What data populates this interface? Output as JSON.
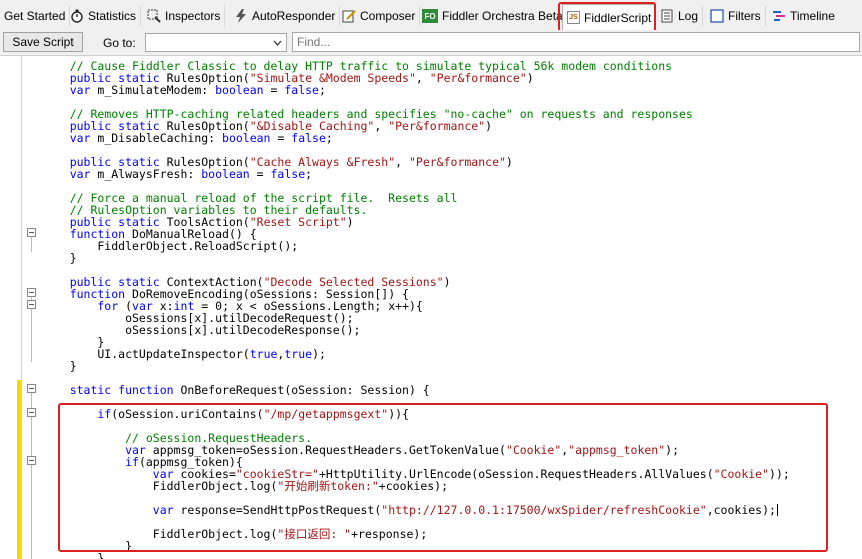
{
  "tabs": [
    {
      "label": "Get Started",
      "icon": "none",
      "active": false
    },
    {
      "label": "Statistics",
      "icon": "stopwatch-icon",
      "active": false
    },
    {
      "label": "Inspectors",
      "icon": "inspect-icon",
      "active": false
    },
    {
      "label": "AutoResponder",
      "icon": "lightning-icon",
      "active": false
    },
    {
      "label": "Composer",
      "icon": "compose-icon",
      "active": false
    },
    {
      "label": "Fiddler Orchestra Beta",
      "icon": "fo-icon",
      "icon_text": "FO",
      "active": false
    },
    {
      "label": "FiddlerScript",
      "icon": "script-icon",
      "icon_text": "JS",
      "active": true
    },
    {
      "label": "Log",
      "icon": "log-icon",
      "active": false
    },
    {
      "label": "Filters",
      "icon": "checkbox-icon",
      "active": false
    },
    {
      "label": "Timeline",
      "icon": "timeline-icon",
      "active": false
    }
  ],
  "toolbar": {
    "save_label": "Save Script",
    "goto_label": "Go to:",
    "goto_value": "",
    "find_placeholder": "Find..."
  },
  "code_lines": [
    [
      [
        "cm",
        "    // Cause Fiddler Classic to delay HTTP traffic to simulate typical 56k modem conditions"
      ]
    ],
    [
      [
        "kw",
        "    public static "
      ],
      [
        "pl",
        "RulesOption("
      ],
      [
        "st",
        "\"Simulate &Modem Speeds\""
      ],
      [
        "pl",
        ", "
      ],
      [
        "st",
        "\"Per&formance\""
      ],
      [
        "pl",
        ")"
      ]
    ],
    [
      [
        "kw",
        "    var "
      ],
      [
        "pl",
        "m_SimulateModem: "
      ],
      [
        "kw",
        "boolean"
      ],
      [
        "pl",
        " = "
      ],
      [
        "kw",
        "false"
      ],
      [
        "pl",
        ";"
      ]
    ],
    [
      [
        "pl",
        ""
      ]
    ],
    [
      [
        "cm",
        "    // Removes HTTP-caching related headers and specifies \"no-cache\" on requests and responses"
      ]
    ],
    [
      [
        "kw",
        "    public static "
      ],
      [
        "pl",
        "RulesOption("
      ],
      [
        "st",
        "\"&Disable Caching\""
      ],
      [
        "pl",
        ", "
      ],
      [
        "st",
        "\"Per&formance\""
      ],
      [
        "pl",
        ")"
      ]
    ],
    [
      [
        "kw",
        "    var "
      ],
      [
        "pl",
        "m_DisableCaching: "
      ],
      [
        "kw",
        "boolean"
      ],
      [
        "pl",
        " = "
      ],
      [
        "kw",
        "false"
      ],
      [
        "pl",
        ";"
      ]
    ],
    [
      [
        "pl",
        ""
      ]
    ],
    [
      [
        "kw",
        "    public static "
      ],
      [
        "pl",
        "RulesOption("
      ],
      [
        "st",
        "\"Cache Always &Fresh\""
      ],
      [
        "pl",
        ", "
      ],
      [
        "st",
        "\"Per&formance\""
      ],
      [
        "pl",
        ")"
      ]
    ],
    [
      [
        "kw",
        "    var "
      ],
      [
        "pl",
        "m_AlwaysFresh: "
      ],
      [
        "kw",
        "boolean"
      ],
      [
        "pl",
        " = "
      ],
      [
        "kw",
        "false"
      ],
      [
        "pl",
        ";"
      ]
    ],
    [
      [
        "pl",
        ""
      ]
    ],
    [
      [
        "cm",
        "    // Force a manual reload of the script file.  Resets all"
      ]
    ],
    [
      [
        "cm",
        "    // RulesOption variables to their defaults."
      ]
    ],
    [
      [
        "kw",
        "    public static "
      ],
      [
        "pl",
        "ToolsAction("
      ],
      [
        "st",
        "\"Reset Script\""
      ],
      [
        "pl",
        ")"
      ]
    ],
    [
      [
        "kw",
        "    function "
      ],
      [
        "pl",
        "DoManualReload() {"
      ]
    ],
    [
      [
        "pl",
        "        FiddlerObject.ReloadScript();"
      ]
    ],
    [
      [
        "pl",
        "    }"
      ]
    ],
    [
      [
        "pl",
        ""
      ]
    ],
    [
      [
        "kw",
        "    public static "
      ],
      [
        "pl",
        "ContextAction("
      ],
      [
        "st",
        "\"Decode Selected Sessions\""
      ],
      [
        "pl",
        ")"
      ]
    ],
    [
      [
        "kw",
        "    function "
      ],
      [
        "pl",
        "DoRemoveEncoding(oSessions: Session[]) {"
      ]
    ],
    [
      [
        "kw",
        "        for "
      ],
      [
        "pl",
        "("
      ],
      [
        "kw",
        "var "
      ],
      [
        "pl",
        "x:"
      ],
      [
        "kw",
        "int"
      ],
      [
        "pl",
        " = 0; x < oSessions.Length; x++){"
      ]
    ],
    [
      [
        "pl",
        "            oSessions[x].utilDecodeRequest();"
      ]
    ],
    [
      [
        "pl",
        "            oSessions[x].utilDecodeResponse();"
      ]
    ],
    [
      [
        "pl",
        "        }"
      ]
    ],
    [
      [
        "pl",
        "        UI.actUpdateInspector("
      ],
      [
        "kw",
        "true"
      ],
      [
        "pl",
        ","
      ],
      [
        "kw",
        "true"
      ],
      [
        "pl",
        ");"
      ]
    ],
    [
      [
        "pl",
        "    }"
      ]
    ],
    [
      [
        "pl",
        ""
      ]
    ],
    [
      [
        "kw",
        "    static function "
      ],
      [
        "pl",
        "OnBeforeRequest(oSession: Session) {"
      ]
    ],
    [
      [
        "pl",
        ""
      ]
    ],
    [
      [
        "kw",
        "        if"
      ],
      [
        "pl",
        "(oSession.uriContains("
      ],
      [
        "st",
        "\"/mp/getappmsgext\""
      ],
      [
        "pl",
        "))"
      ],
      [
        "pl",
        "{"
      ]
    ],
    [
      [
        "pl",
        ""
      ]
    ],
    [
      [
        "cm",
        "            // oSession.RequestHeaders."
      ]
    ],
    [
      [
        "kw",
        "            var "
      ],
      [
        "pl",
        "appmsg_token=oSession.RequestHeaders.GetTokenValue("
      ],
      [
        "st",
        "\"Cookie\""
      ],
      [
        "pl",
        ","
      ],
      [
        "st",
        "\"appmsg_token\""
      ],
      [
        "pl",
        ");"
      ]
    ],
    [
      [
        "kw",
        "            if"
      ],
      [
        "pl",
        "(appmsg_token){"
      ]
    ],
    [
      [
        "kw",
        "                var "
      ],
      [
        "pl",
        "cookies="
      ],
      [
        "st",
        "\"cookieStr=\""
      ],
      [
        "pl",
        "+HttpUtility.UrlEncode(oSession.RequestHeaders.AllValues("
      ],
      [
        "st",
        "\"Cookie\""
      ],
      [
        "pl",
        "));"
      ]
    ],
    [
      [
        "pl",
        "                FiddlerObject.log("
      ],
      [
        "st",
        "\"开始刷新token:\""
      ],
      [
        "pl",
        "+cookies);"
      ]
    ],
    [
      [
        "pl",
        ""
      ]
    ],
    [
      [
        "kw",
        "                var "
      ],
      [
        "pl",
        "response=SendHttpPostRequest("
      ],
      [
        "st",
        "\"http://127.0.0.1:17500/wxSpider/refreshCookie\""
      ],
      [
        "pl",
        ",cookies);"
      ]
    ],
    [
      [
        "pl",
        ""
      ]
    ],
    [
      [
        "pl",
        "                FiddlerObject.log("
      ],
      [
        "st",
        "\"接口返回: \""
      ],
      [
        "pl",
        "+response);"
      ]
    ],
    [
      [
        "pl",
        "            }"
      ]
    ],
    [
      [
        "pl",
        "        }"
      ]
    ]
  ]
}
